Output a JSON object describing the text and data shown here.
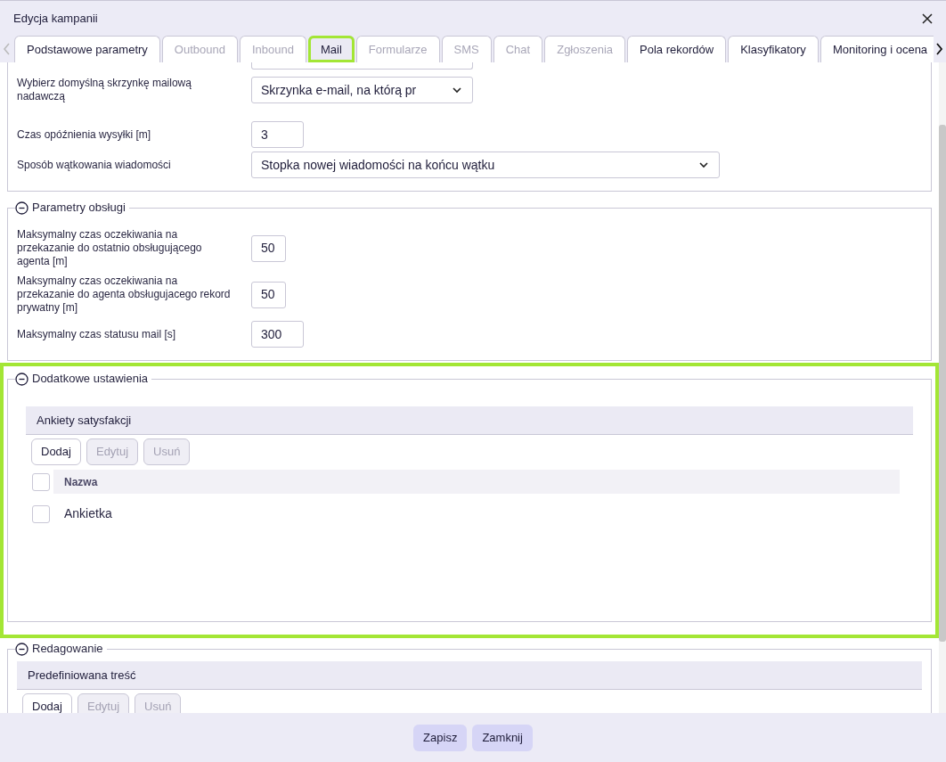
{
  "window": {
    "title": "Edycja kampanii"
  },
  "tabs": [
    {
      "label": "Podstawowe parametry",
      "selected": false,
      "disabled": false,
      "highlighted": false
    },
    {
      "label": "Outbound",
      "selected": false,
      "disabled": true,
      "highlighted": false
    },
    {
      "label": "Inbound",
      "selected": false,
      "disabled": true,
      "highlighted": false
    },
    {
      "label": "Mail",
      "selected": true,
      "disabled": false,
      "highlighted": true
    },
    {
      "label": "Formularze",
      "selected": false,
      "disabled": true,
      "highlighted": false
    },
    {
      "label": "SMS",
      "selected": false,
      "disabled": true,
      "highlighted": false
    },
    {
      "label": "Chat",
      "selected": false,
      "disabled": true,
      "highlighted": false
    },
    {
      "label": "Zgłoszenia",
      "selected": false,
      "disabled": true,
      "highlighted": false
    },
    {
      "label": "Pola rekordów",
      "selected": false,
      "disabled": false,
      "highlighted": false
    },
    {
      "label": "Klasyfikatory",
      "selected": false,
      "disabled": false,
      "highlighted": false
    },
    {
      "label": "Monitoring i ocena",
      "selected": false,
      "disabled": false,
      "highlighted": false
    }
  ],
  "mail_settings": {
    "fields": [
      {
        "kind": "select",
        "label": "Wybierz domyślną skrzynkę mailową nadawczą",
        "value": "Skrzynka e-mail,  na którą pr"
      },
      {
        "kind": "input",
        "label": "Czas opóźnienia wysyłki [m]",
        "value": "3"
      },
      {
        "kind": "select",
        "label": "Sposób wątkowania wiadomości",
        "value": "Stopka nowej wiadomości na końcu wątku"
      }
    ]
  },
  "sections": [
    {
      "kind": "fields",
      "title": "Parametry obsługi",
      "expanded": true,
      "highlighted": false,
      "fields": [
        {
          "label": "Maksymalny czas oczekiwania na przekazanie do ostatnio obsługującego agenta [m]",
          "value": "50"
        },
        {
          "label": "Maksymalny czas oczekiwania na przekazanie do agenta obsługujacego rekord prywatny [m]",
          "value": "50"
        },
        {
          "label": "Maksymalny czas statusu mail [s]",
          "value": "300"
        }
      ]
    },
    {
      "kind": "list",
      "title": "Dodatkowe ustawienia",
      "expanded": true,
      "highlighted": true,
      "panel_title": "Ankiety satysfakcji",
      "buttons": [
        {
          "label": "Dodaj",
          "disabled": false
        },
        {
          "label": "Edytuj",
          "disabled": true
        },
        {
          "label": "Usuń",
          "disabled": true
        }
      ],
      "column": "Nazwa",
      "header_checked": false,
      "rows": [
        {
          "name": "Ankietka",
          "checked": false
        }
      ]
    },
    {
      "kind": "list",
      "title": "Redagowanie",
      "expanded": true,
      "highlighted": false,
      "panel_title": "Predefiniowana treść",
      "buttons": [
        {
          "label": "Dodaj",
          "disabled": false
        },
        {
          "label": "Edytuj",
          "disabled": true
        },
        {
          "label": "Usuń",
          "disabled": true
        }
      ]
    }
  ],
  "footer": {
    "buttons": [
      "Zapisz",
      "Zamknij"
    ]
  }
}
